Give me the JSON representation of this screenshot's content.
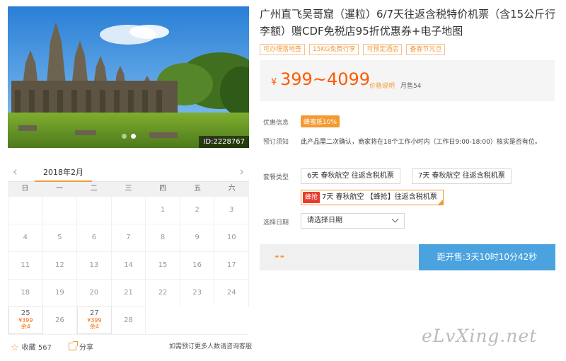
{
  "product": {
    "title": "广州直飞吴哥窟（暹粒）6/7天往返含税特价机票（含15公斤行李额）赠CDF免税店95折优惠券+电子地图",
    "tags": [
      "可办理落地签",
      "15KG免费行李",
      "可预定酒店",
      "备春节元旦"
    ],
    "price": {
      "currency": "¥",
      "range": "399~4099",
      "explain_label": "价格说明",
      "sold": "月售54"
    }
  },
  "hero": {
    "id_tag": "ID:2228767",
    "slides": 2,
    "active_slide": 2
  },
  "calendar": {
    "month": "2018年2月",
    "weekdays": [
      "日",
      "一",
      "二",
      "三",
      "四",
      "五",
      "六"
    ],
    "days": [
      {
        "d": ""
      },
      {
        "d": ""
      },
      {
        "d": ""
      },
      {
        "d": ""
      },
      {
        "d": "1"
      },
      {
        "d": "2"
      },
      {
        "d": "3"
      },
      {
        "d": "4"
      },
      {
        "d": "5"
      },
      {
        "d": "6"
      },
      {
        "d": "7"
      },
      {
        "d": "8"
      },
      {
        "d": "9"
      },
      {
        "d": "10"
      },
      {
        "d": "11"
      },
      {
        "d": "12"
      },
      {
        "d": "13"
      },
      {
        "d": "14"
      },
      {
        "d": "15"
      },
      {
        "d": "16"
      },
      {
        "d": "17"
      },
      {
        "d": "18"
      },
      {
        "d": "19"
      },
      {
        "d": "20"
      },
      {
        "d": "21"
      },
      {
        "d": "22"
      },
      {
        "d": "23"
      },
      {
        "d": "24"
      },
      {
        "d": "25",
        "price": "¥399",
        "remain": "余4"
      },
      {
        "d": "26"
      },
      {
        "d": "27",
        "price": "¥399",
        "remain": "余4"
      },
      {
        "d": "28"
      }
    ]
  },
  "actions": {
    "favorite": "收藏 567",
    "share": "分享",
    "note": "如需预订更多人数请咨询客服"
  },
  "promo": {
    "label": "优惠信息",
    "badge": "蜂蜜抵10%"
  },
  "booking_notice": {
    "label": "预订须知",
    "text": "此产品需二次确认，商家将在18个工作小时内（工作日9:00-18:00）核实是否有位。"
  },
  "packages": {
    "label": "套餐类型",
    "options": [
      {
        "text": "6天 春秋航空 往返含税机票"
      },
      {
        "text": "7天 春秋航空 往返含税机票"
      },
      {
        "badge": "蜂抢",
        "text": "7天 春秋航空 【蜂抢】往返含税机票",
        "selected": true
      }
    ]
  },
  "date_picker": {
    "label": "选择日期",
    "placeholder": "请选择日期"
  },
  "purchase": {
    "dash": "--",
    "countdown": "距开售:3天10时10分42秒"
  },
  "watermark": "eLvXing.net",
  "colors": {
    "accent": "#f29a38",
    "price": "#ff5a00",
    "button": "#4aa3df",
    "hot_badge": "#e83c2f"
  }
}
